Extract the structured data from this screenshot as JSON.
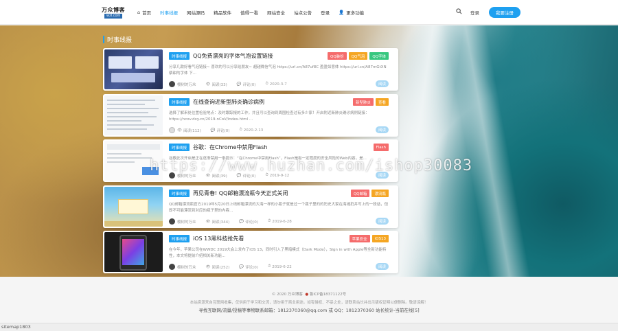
{
  "header": {
    "logo_main": "万众博客",
    "logo_sub": "wzl.com",
    "nav": [
      {
        "label": "首页",
        "icon": "home-icon"
      },
      {
        "label": "时事线报",
        "active": true
      },
      {
        "label": "网站源码"
      },
      {
        "label": "精品软件"
      },
      {
        "label": "值得一看"
      },
      {
        "label": "网站安全"
      },
      {
        "label": "站点公告"
      },
      {
        "label": "登录"
      },
      {
        "label": "更多功能",
        "icon": "user-icon"
      }
    ],
    "login": "登录",
    "register": "我要注册"
  },
  "section_title": "时事线报",
  "articles": [
    {
      "category": "时事线报",
      "title": "QQ免费漂亮的字体气泡设置链接",
      "tags": [
        {
          "label": "QQ装扮",
          "color": "#f56c6c"
        },
        {
          "label": "QQ气泡",
          "color": "#f5a623"
        },
        {
          "label": "QQ字体",
          "color": "#37c77f"
        }
      ],
      "excerpt": "分享几款好看气泡链接~ 喜欢的可以分享给朋友~ 超越微信气泡 https://url.cn/A87uf8C 盈盈如意体 https://url.cn/A87mGtXN 蔡甜的字体 下...",
      "author": "樱树的万众",
      "views": "阅读(33)",
      "comments": "评论(0)",
      "date": "2020-3-7",
      "read": "阅读"
    },
    {
      "category": "时事线报",
      "title": "在线查询近新型肺炎确诊病例",
      "tags": [
        {
          "label": "新型肺炎",
          "color": "#f56c6c"
        },
        {
          "label": "查看",
          "color": "#f5a623"
        }
      ],
      "excerpt": "选择了解来处位置检验地点：及时跟踪报的工作，并且可以查询到周围检查过有多少家！开启附近新肺炎确诊病例链接：https://ncov.dxy.cn/2019-nCoV/index.html ...",
      "author": "",
      "views": "阅读(112)",
      "comments": "评论(0)",
      "date": "2020-2-13",
      "read": "阅读"
    },
    {
      "category": "时事线报",
      "title": "谷歌：在Chrome中禁用Flash",
      "tags": [
        {
          "label": "Flash",
          "color": "#f56c6c"
        }
      ],
      "excerpt": "谷歌此次开启是正在逐渐禁用一条提示：“在Chrome中禁用Flash”，Flash是有一定程度的安全风险的Web内容，是...",
      "author": "樱树的万众",
      "views": "阅读(39)",
      "comments": "评论(0)",
      "date": "2019-9-12",
      "read": "阅读"
    },
    {
      "category": "时事线报",
      "title": "再见青春! QQ邮箱漂流瓶今天正式关闭",
      "tags": [
        {
          "label": "QQ邮箱",
          "color": "#f56c6c"
        },
        {
          "label": "漂流瓶",
          "color": "#f5a623"
        }
      ],
      "excerpt": "QQ邮箱漂流瓶官方2019年5月20日上线邮箱漂流的大海一样的小瓶子就是过一个瓶子里的的历史大家在海滩扔并写上的一段话，但即不可能漂流到对应的瓶子里的内容...",
      "author": "樱树的万众",
      "views": "阅读(344)",
      "comments": "评论(0)",
      "date": "2019-6-28",
      "read": "阅读"
    },
    {
      "category": "时事线报",
      "title": "iOS 13黑科技抢先看",
      "tags": [
        {
          "label": "苹果安全",
          "color": "#f56c6c"
        },
        {
          "label": "iOS13",
          "color": "#f5a623"
        }
      ],
      "excerpt": "在今年，苹果公司在WWDC 2019大会上发布了iOS 13，同时引入了黑暗模式（Dark Mode），Sign in with Apple等全新功能特性，本文将提前介绍相关新功能...",
      "author": "樱树的万众",
      "views": "阅读(252)",
      "comments": "评论(0)",
      "date": "2019-6-22",
      "read": "阅读"
    }
  ],
  "watermark": "https://www.huzhan.com/ishop30083",
  "footer": {
    "copyright": "© 2020 万众博客",
    "icp": "鲁ICP备18371122号",
    "disclaimer": "本站资源来自互联网收集，仅供用于学习和交流，请勿用于商业用途。如有侵权、不妥之处，请联系站长并出示版权证明以便删除。敬请谅解！",
    "contact": "寻找互联网/流量/投稿等事物联系邮箱：1812370360@qq.com 或 QQ：1812370360 站长统计-当前在线[5]"
  },
  "sitemap": "sitemap1803"
}
